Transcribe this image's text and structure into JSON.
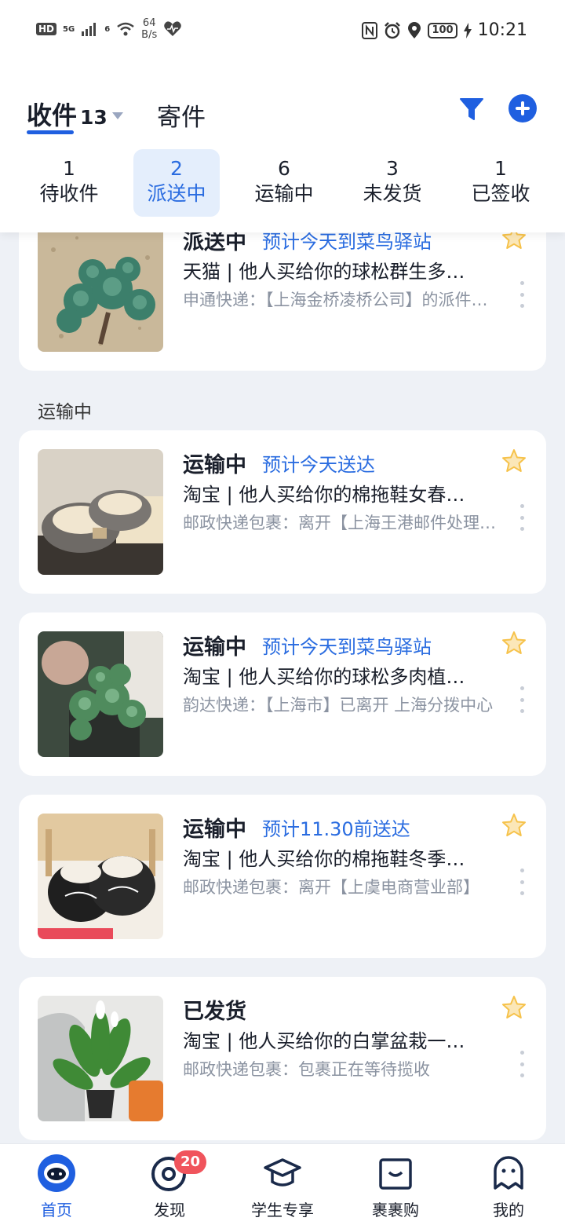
{
  "status_bar": {
    "hd": "HD",
    "sig1": "5G",
    "sig2": "6",
    "speed_value": "64",
    "speed_unit": "B/s",
    "battery": "100",
    "time": "10:21"
  },
  "header": {
    "received_label": "收件",
    "received_count": "13",
    "sent_label": "寄件"
  },
  "status_filters": [
    {
      "count": "1",
      "label": "待收件"
    },
    {
      "count": "2",
      "label": "派送中"
    },
    {
      "count": "6",
      "label": "运输中"
    },
    {
      "count": "3",
      "label": "未发货"
    },
    {
      "count": "1",
      "label": "已签收"
    }
  ],
  "section_in_transit": "运输中",
  "packages": [
    {
      "status": "派送中",
      "eta": "预计今天到菜鸟驿站",
      "title": "天猫 | 他人买给你的球松群生多肉植物",
      "tracking": "申通快递：【上海金桥凌桥公司】的派件员正在派件"
    },
    {
      "status": "运输中",
      "eta": "预计今天送达",
      "title": "淘宝 | 他人买给你的棉拖鞋女春秋季",
      "tracking": "邮政快递包裹：离开【上海王港邮件处理中心】"
    },
    {
      "status": "运输中",
      "eta": "预计今天到菜鸟驿站",
      "title": "淘宝 | 他人买给你的球松多肉植物盆栽",
      "tracking": "韵达快递：【上海市】已离开 上海分拨中心"
    },
    {
      "status": "运输中",
      "eta": "预计11.30前送达",
      "title": "淘宝 | 他人买给你的棉拖鞋冬季男女",
      "tracking": "邮政快递包裹：离开【上虞电商营业部】"
    },
    {
      "status": "已发货",
      "eta": "",
      "title": "淘宝 | 他人买给你的白掌盆栽一帆风顺",
      "tracking": "邮政快递包裹：包裹正在等待揽收"
    }
  ],
  "tabbar": {
    "home": "首页",
    "discover": "发现",
    "discover_badge": "20",
    "student": "学生专享",
    "shop": "裹裹购",
    "me": "我的"
  },
  "colors": {
    "accent": "#1f5fe0",
    "eta_blue": "#2a6ce0",
    "star": "#f6c24a",
    "badge": "#f0545c"
  }
}
